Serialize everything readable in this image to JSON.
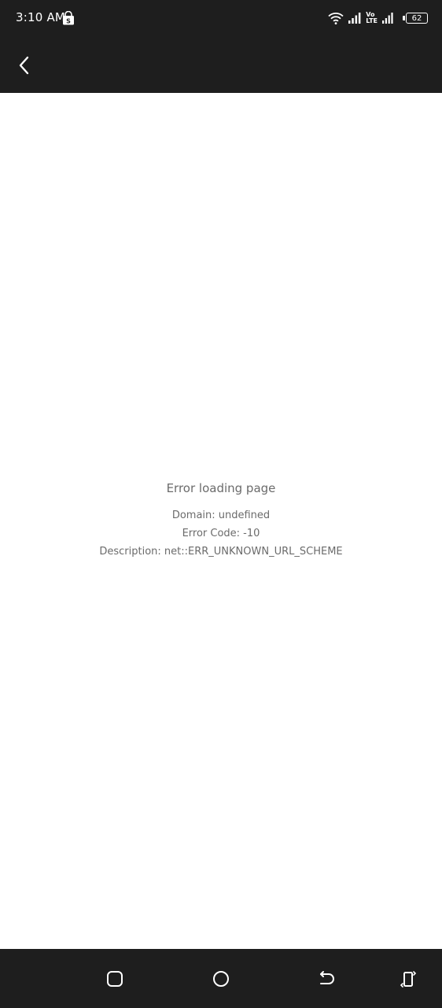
{
  "status_bar": {
    "time": "3:10 AM",
    "volte_top": "Vo",
    "volte_bottom": "LTE",
    "battery": "62"
  },
  "app_bar": {
    "back_icon": "chevron-left-icon"
  },
  "error": {
    "title": "Error loading page",
    "domain": "Domain: undefined",
    "code": "Error Code: -10",
    "description": "Description: net::ERR_UNKNOWN_URL_SCHEME"
  },
  "nav_bar": {
    "icons": [
      "recent-apps-icon",
      "home-icon",
      "back-icon",
      "rotate-icon"
    ]
  },
  "colors": {
    "bar_background": "#1e1e1e",
    "page_background": "#ffffff",
    "error_text": "#6b6b6b"
  }
}
